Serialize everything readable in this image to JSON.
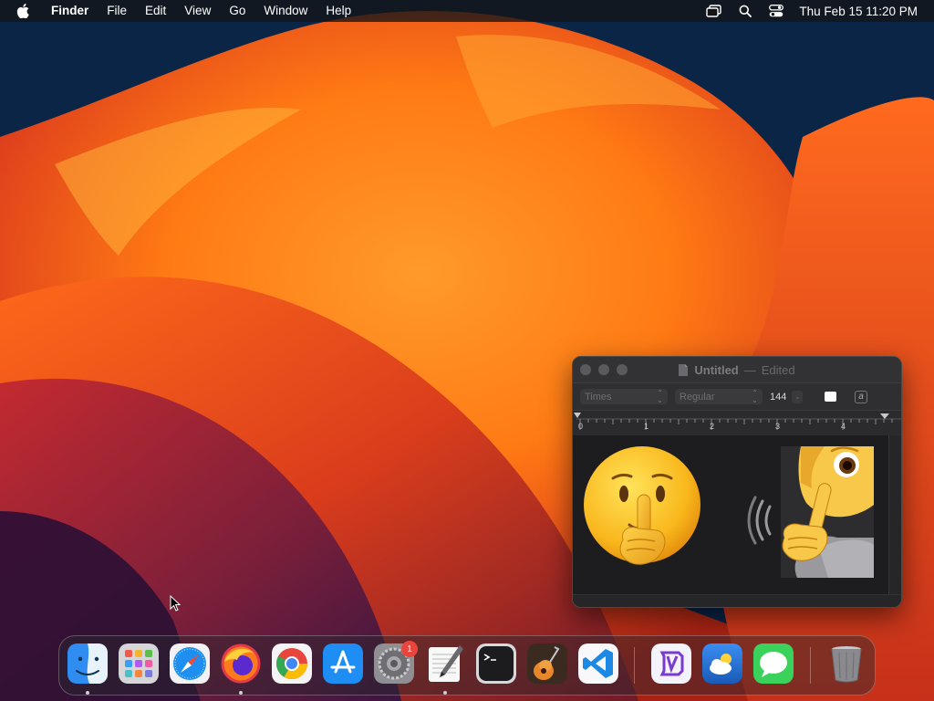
{
  "menubar": {
    "app_name": "Finder",
    "menus": [
      "File",
      "Edit",
      "View",
      "Go",
      "Window",
      "Help"
    ],
    "clock": "Thu Feb 15  11:20 PM",
    "status_icons": [
      "screen-mirroring-icon",
      "spotlight-search-icon",
      "control-center-icon"
    ]
  },
  "textedit_window": {
    "title": "Untitled",
    "separator": "—",
    "state": "Edited",
    "font_family": "Times",
    "font_style": "Regular",
    "font_size": "144",
    "bg_color_label": "a",
    "ruler_labels": [
      "0",
      "1",
      "2",
      "3",
      "4"
    ],
    "content_emojis": [
      "shushing-face",
      "person-shushing"
    ]
  },
  "dock": {
    "apps": [
      {
        "name": "Finder",
        "running": true
      },
      {
        "name": "Launchpad",
        "running": false
      },
      {
        "name": "Safari",
        "running": false
      },
      {
        "name": "Firefox",
        "running": true
      },
      {
        "name": "Google Chrome",
        "running": false
      },
      {
        "name": "App Store",
        "running": false
      },
      {
        "name": "System Settings",
        "running": false,
        "badge": "1"
      },
      {
        "name": "TextEdit",
        "running": true
      },
      {
        "name": "Terminal",
        "running": false
      },
      {
        "name": "GarageBand",
        "running": false
      },
      {
        "name": "Visual Studio Code",
        "running": false
      },
      {
        "name": "Visual Studio",
        "running": false
      },
      {
        "name": "Weather",
        "running": false
      },
      {
        "name": "Messages",
        "running": false
      },
      {
        "name": "Trash",
        "running": false
      }
    ]
  },
  "colors": {
    "wallpaper_orange": "#ff8a1e",
    "wallpaper_red": "#c8301a",
    "wallpaper_navy": "#0b2547",
    "badge_red": "#e8453c"
  }
}
